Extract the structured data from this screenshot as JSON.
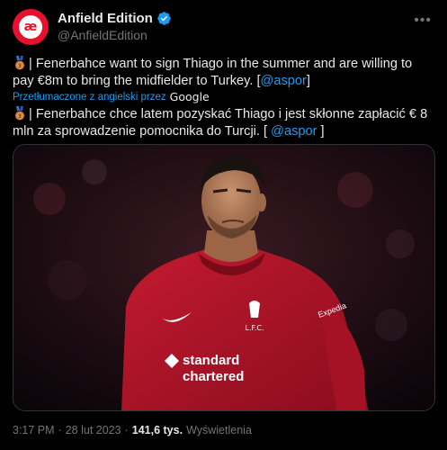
{
  "author": {
    "display_name": "Anfield Edition",
    "handle": "@AnfieldEdition",
    "avatar_text": "æ",
    "verified_icon": "verified-badge-icon",
    "brand_color": "#e8112d"
  },
  "tweet": {
    "original_text": "| Fenerbahce want to sign Thiago in the summer and are willing to pay €8m to bring the midfielder to Turkey. [",
    "original_mention": "@aspor",
    "original_suffix": "]",
    "translated_label": "Przetłumaczone z angielski przez",
    "translator": "Google",
    "translated_text": "| Fenerbahce chce latem pozyskać Thiago i jest skłonne zapłacić € 8 mln za sprowadzenie pomocnika do Turcji. [ ",
    "translated_mention": "@aspor",
    "translated_suffix": " ]",
    "medal_icon": "bronze-medal-icon"
  },
  "photo": {
    "kit_sponsor": "Standard Chartered",
    "kit_sponsor_line1": "standard",
    "kit_sponsor_line2": "chartered",
    "crest_text": "L.F.C.",
    "sleeve_text": "Expedia",
    "kit_color": "#b5142a"
  },
  "meta": {
    "time": "3:17 PM",
    "sep1": "·",
    "date": "28 lut 2023",
    "sep2": "·",
    "views_count": "141,6 tys.",
    "views_label": "Wyświetlenia"
  }
}
